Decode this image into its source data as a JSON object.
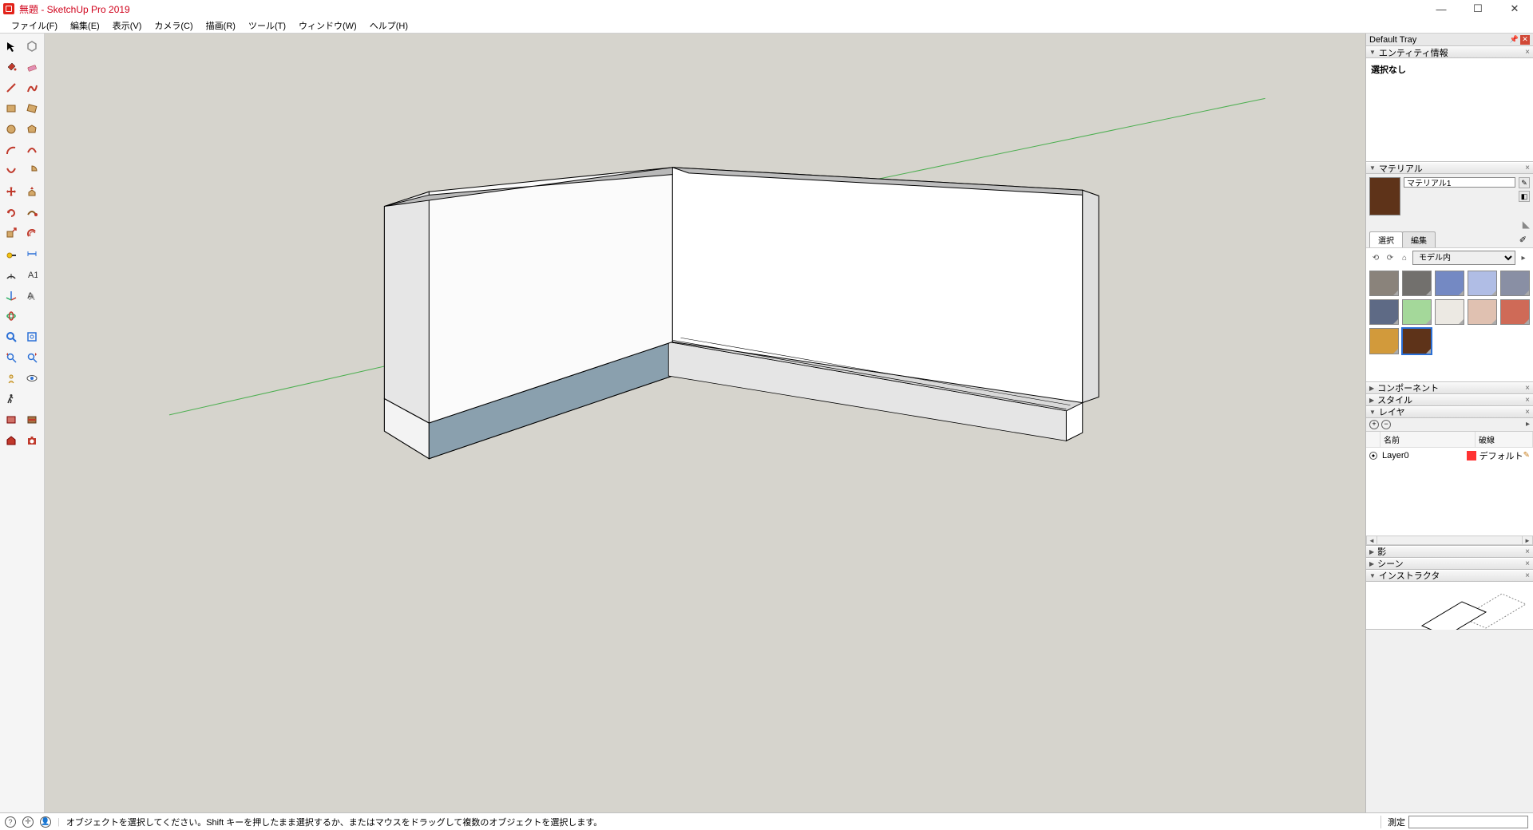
{
  "title": "無題 - SketchUp Pro 2019",
  "menus": [
    "ファイル(F)",
    "編集(E)",
    "表示(V)",
    "カメラ(C)",
    "描画(R)",
    "ツール(T)",
    "ウィンドウ(W)",
    "ヘルプ(H)"
  ],
  "toolbar_rows": [
    [
      "select-tool",
      "make-component-tool"
    ],
    [
      "paint-bucket-tool",
      "eraser-tool"
    ],
    [
      "line-tool",
      "freehand-tool"
    ],
    [
      "rectangle-tool",
      "rotated-rectangle-tool"
    ],
    [
      "circle-tool",
      "polygon-tool"
    ],
    [
      "arc-tool",
      "two-point-arc-tool"
    ],
    [
      "three-point-arc-tool",
      "pie-tool"
    ],
    [
      "move-tool",
      "push-pull-tool"
    ],
    [
      "rotate-tool",
      "follow-me-tool"
    ],
    [
      "scale-tool",
      "offset-tool"
    ],
    [
      "tape-measure-tool",
      "dimension-tool"
    ],
    [
      "protractor-tool",
      "text-tool"
    ],
    [
      "axes-tool",
      "3d-text-tool"
    ],
    [
      "orbit-tool",
      "pan-tool"
    ],
    [
      "zoom-tool",
      "zoom-extents-tool"
    ],
    [
      "previous-view-tool",
      "next-view-tool"
    ],
    [
      "position-camera-tool",
      "look-around-tool"
    ],
    [
      "walk-tool",
      ""
    ],
    [
      "section-plane-tool",
      "section-display-tool"
    ],
    [
      "3d-warehouse-tool",
      "extension-warehouse-tool"
    ]
  ],
  "tray": {
    "title": "Default Tray",
    "panels": {
      "entity_info": {
        "title": "エンティティ情報",
        "content": "選択なし"
      },
      "materials": {
        "title": "マテリアル",
        "sample_color": "#5e3319",
        "name": "マテリアル1",
        "tabs": {
          "select": "選択",
          "edit": "編集"
        },
        "collection": "モデル内",
        "swatches": [
          "#8a837b",
          "#72706d",
          "#7489c3",
          "#b0bde5",
          "#898fa4",
          "#5e6a85",
          "#a4d89a",
          "#ece9e3",
          "#e0c1b1",
          "#cf6a57",
          "#d29a3b",
          "#5e3319"
        ],
        "selected_index": 11
      },
      "components": {
        "title": "コンポーネント"
      },
      "styles": {
        "title": "スタイル"
      },
      "layers": {
        "title": "レイヤ",
        "columns": {
          "name": "名前",
          "dashes": "破線"
        },
        "rows": [
          {
            "name": "Layer0",
            "dash": "デフォルト"
          }
        ]
      },
      "shadows": {
        "title": "影"
      },
      "scenes": {
        "title": "シーン"
      },
      "instructor": {
        "title": "インストラクタ"
      }
    }
  },
  "status": {
    "hint": "オブジェクトを選択してください。Shift キーを押したまま選択するか、またはマウスをドラッグして複数のオブジェクトを選択します。",
    "measure_label": "測定"
  }
}
